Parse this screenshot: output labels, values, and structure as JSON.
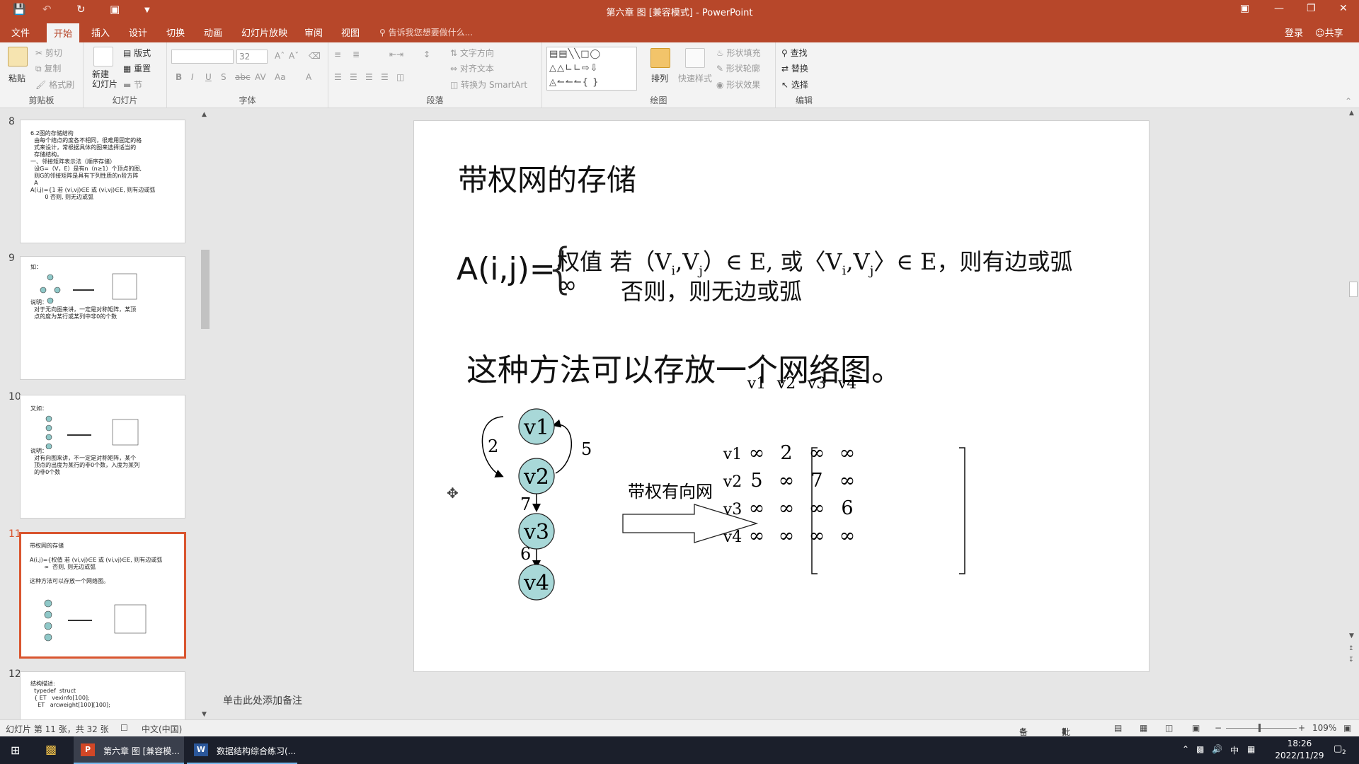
{
  "titlebar": {
    "title": "第六章 图 [兼容模式] - PowerPoint",
    "icons": [
      "save-icon",
      "undo-icon",
      "redo-icon",
      "present-from-start-icon",
      "customize-qat-icon"
    ],
    "window_buttons": [
      "ribbon-display-options-icon",
      "minimize-icon",
      "restore-icon",
      "close-icon"
    ]
  },
  "tabs": {
    "items": [
      "文件",
      "开始",
      "插入",
      "设计",
      "切换",
      "动画",
      "幻灯片放映",
      "审阅",
      "视图"
    ],
    "active": "开始",
    "tell_me": "告诉我您想要做什么...",
    "login": "登录",
    "share": "共享"
  },
  "ribbon": {
    "clipboard": {
      "label": "剪贴板",
      "paste": "粘贴",
      "cut": "剪切",
      "copy": "复制",
      "format_painter": "格式刷"
    },
    "slides": {
      "label": "幻灯片",
      "new_slide": "新建\n幻灯片",
      "layout": "版式",
      "reset": "重置",
      "section": "节"
    },
    "font": {
      "label": "字体",
      "font_name": "",
      "font_size": "32",
      "buttons": [
        "B",
        "I",
        "U",
        "S",
        "abc",
        "AV",
        "Aa",
        "A"
      ]
    },
    "paragraph": {
      "label": "段落",
      "text_direction": "文字方向",
      "align_text": "对齐文本",
      "smartart": "转换为 SmartArt"
    },
    "drawing": {
      "label": "绘图",
      "arrange": "排列",
      "quick_styles": "快速样式",
      "shape_fill": "形状填充",
      "shape_outline": "形状轮廓",
      "shape_effects": "形状效果"
    },
    "editing": {
      "label": "编辑",
      "find": "查找",
      "replace": "替换",
      "select": "选择"
    }
  },
  "thumbnails": [
    {
      "num": "8",
      "lines": [
        "6.2图的存储结构",
        "  由每个结点的度各不相同，很难用固定的格",
        "  式来设计，常根据具体的图来选择适当的",
        "  存储结构。",
        "一、邻接矩阵表示法（顺序存储）",
        "  设G=（V，E）是有n（n≥1）个顶点的图,",
        "  则G的邻接矩阵是具有下列性质的n阶方阵",
        "  A",
        "A(i,j)={1 若 (vi,vj)∈E 或 (vi,vj)∈E, 则有边或弧",
        "        0 否则, 则无边或弧"
      ]
    },
    {
      "num": "9",
      "lines": [
        "如：",
        "",
        "",
        "",
        "",
        "说明：",
        "  对于无向图来讲，一定是对称矩阵，某顶",
        "  点的度为某行或某列中非0的个数"
      ]
    },
    {
      "num": "10",
      "lines": [
        "又如：",
        "",
        "",
        "",
        "",
        "",
        "说明：",
        "  对有向图来讲，不一定是对称矩阵，某个",
        "  顶点的出度为某行的非0个数，入度为某列",
        "  的非0个数"
      ]
    },
    {
      "num": "11",
      "lines": [
        "带权网的存储",
        "",
        "A(i,j)={权值 若 (vi,vj)∈E 或 (vi,vj)∈E, 则有边或弧",
        "        ∞  否则, 则无边或弧",
        "",
        "这种方法可以存放一个网络图。"
      ]
    },
    {
      "num": "12",
      "lines": [
        "结构描述:",
        "  typedef  struct",
        "  { ET   vexinfo[100];",
        "    ET   arcweight[100][100];"
      ]
    }
  ],
  "slide": {
    "title": "带权网的存储",
    "formula_lhs": "A(i,j)=",
    "formula_case1_weight": "权值",
    "formula_case1_condition": "若（V",
    "formula_case1_rest": "）∈ E, 或〈V",
    "formula_case1_end": "〉∈ E，则有边或弧",
    "sub_i": "i",
    "sub_j": "j",
    "comma": ",",
    "formula_case2_symbol": "∞",
    "formula_case2_text": "否则，则无边或弧",
    "description": "这种方法可以存放一个网络图。",
    "graph": {
      "nodes": [
        "v1",
        "v2",
        "v3",
        "v4"
      ],
      "edges": [
        {
          "from": "v1",
          "to": "v2",
          "weight": "2"
        },
        {
          "from": "v2",
          "to": "v1",
          "weight": "5"
        },
        {
          "from": "v2",
          "to": "v3",
          "weight": "7"
        },
        {
          "from": "v3",
          "to": "v4",
          "weight": "6"
        }
      ]
    },
    "arrow_label": "带权有向网",
    "matrix": {
      "col_headers": [
        "v1",
        "v2",
        "v3",
        "v4"
      ],
      "row_headers": [
        "v1",
        "v2",
        "v3",
        "v4"
      ],
      "rows": [
        [
          "∞",
          "2",
          "∞",
          "∞"
        ],
        [
          "5",
          "∞",
          "7",
          "∞"
        ],
        [
          "∞",
          "∞",
          "∞",
          "6"
        ],
        [
          "∞",
          "∞",
          "∞",
          "∞"
        ]
      ]
    }
  },
  "notes_placeholder": "单击此处添加备注",
  "status": {
    "slide_info": "幻灯片 第 11 张，共 32 张",
    "language": "中文(中国)",
    "notes": "备注",
    "comments": "批注",
    "zoom": "109%"
  },
  "taskbar": {
    "apps": [
      {
        "label": "第六章 图 [兼容模...",
        "active": true
      },
      {
        "label": "数据结构综合练习(...",
        "active": false
      }
    ],
    "ime": "中",
    "time": "18:26",
    "date": "2022/11/29",
    "notifications": "2"
  }
}
